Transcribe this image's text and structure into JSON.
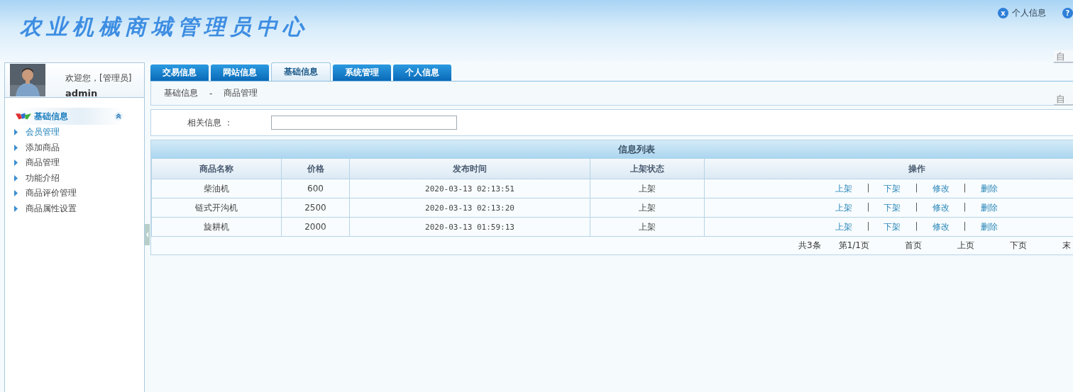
{
  "header": {
    "title": "农业机械商城管理员中心",
    "links": [
      {
        "icon": "x",
        "label": "个人信息"
      },
      {
        "icon": "?"
      }
    ]
  },
  "right_edge": [
    "自",
    "自"
  ],
  "user": {
    "greeting": "欢迎您，[管理员]",
    "name": "admin"
  },
  "sidebar": {
    "section": {
      "label": "基础信息",
      "expanded": true
    },
    "items": [
      {
        "label": "会员管理",
        "selected": true
      },
      {
        "label": "添加商品",
        "selected": false
      },
      {
        "label": "商品管理",
        "selected": false
      },
      {
        "label": "功能介绍",
        "selected": false
      },
      {
        "label": "商品评价管理",
        "selected": false
      },
      {
        "label": "商品属性设置",
        "selected": false
      }
    ]
  },
  "tabs": [
    {
      "label": "交易信息",
      "selected": false
    },
    {
      "label": "网站信息",
      "selected": false
    },
    {
      "label": "基础信息",
      "selected": true
    },
    {
      "label": "系统管理",
      "selected": false
    },
    {
      "label": "个人信息",
      "selected": false
    }
  ],
  "breadcrumb": [
    "基础信息",
    "-",
    "商品管理"
  ],
  "search": {
    "label": "相关信息 ："
  },
  "table": {
    "title": "信息列表",
    "columns": [
      "商品名称",
      "价格",
      "发布时间",
      "上架状态",
      "操作"
    ],
    "separator": "|",
    "rows": [
      {
        "cells": [
          "柴油机",
          "600",
          "2020-03-13 02:13:51",
          "上架"
        ],
        "actions": [
          "上架",
          "下架",
          "修改",
          "删除"
        ]
      },
      {
        "cells": [
          "链式开沟机",
          "2500",
          "2020-03-13 02:13:20",
          "上架"
        ],
        "actions": [
          "上架",
          "下架",
          "修改",
          "删除"
        ]
      },
      {
        "cells": [
          "旋耕机",
          "2000",
          "2020-03-13 01:59:13",
          "上架"
        ],
        "actions": [
          "上架",
          "下架",
          "修改",
          "删除"
        ]
      }
    ],
    "pagination": [
      "共3条",
      "第1/1页",
      "首页",
      "上页",
      "下页",
      "末"
    ]
  }
}
